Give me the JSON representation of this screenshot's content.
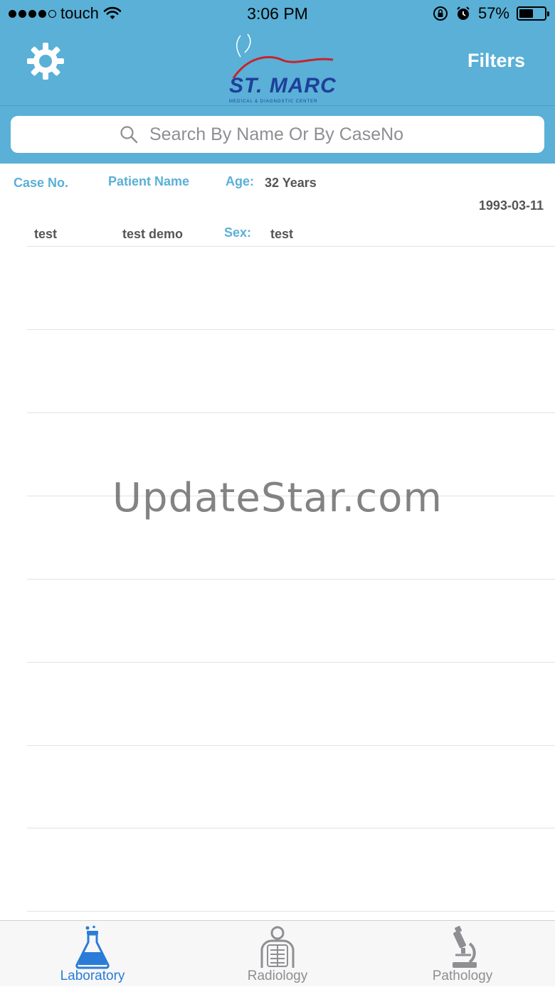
{
  "status_bar": {
    "carrier": "touch",
    "time": "3:06 PM",
    "battery_percent": "57%",
    "battery_level": 0.57
  },
  "header": {
    "logo_text": "ST. MARC",
    "logo_subtext": "MEDICAL & DIAGNOSTIC CENTER",
    "filters_label": "Filters",
    "settings_icon": "gear-icon"
  },
  "search": {
    "placeholder": "Search By Name Or By CaseNo"
  },
  "record": {
    "case_no_label": "Case No.",
    "patient_name_label": "Patient Name",
    "age_label": "Age:",
    "age_value": "32 Years",
    "date": "1993-03-11",
    "case_no_value": "test",
    "patient_name_value": "test demo",
    "sex_label": "Sex:",
    "sex_value": "test"
  },
  "tabs": [
    {
      "label": "Laboratory",
      "icon": "flask-icon",
      "active": true
    },
    {
      "label": "Radiology",
      "icon": "xray-icon",
      "active": false
    },
    {
      "label": "Pathology",
      "icon": "microscope-icon",
      "active": false
    }
  ],
  "watermark": "UpdateStar.com",
  "colors": {
    "header_bg": "#5ab0d6",
    "accent_label": "#5ab0d6",
    "active_tab": "#2b7bd9",
    "inactive_tab": "#8e8e93"
  }
}
